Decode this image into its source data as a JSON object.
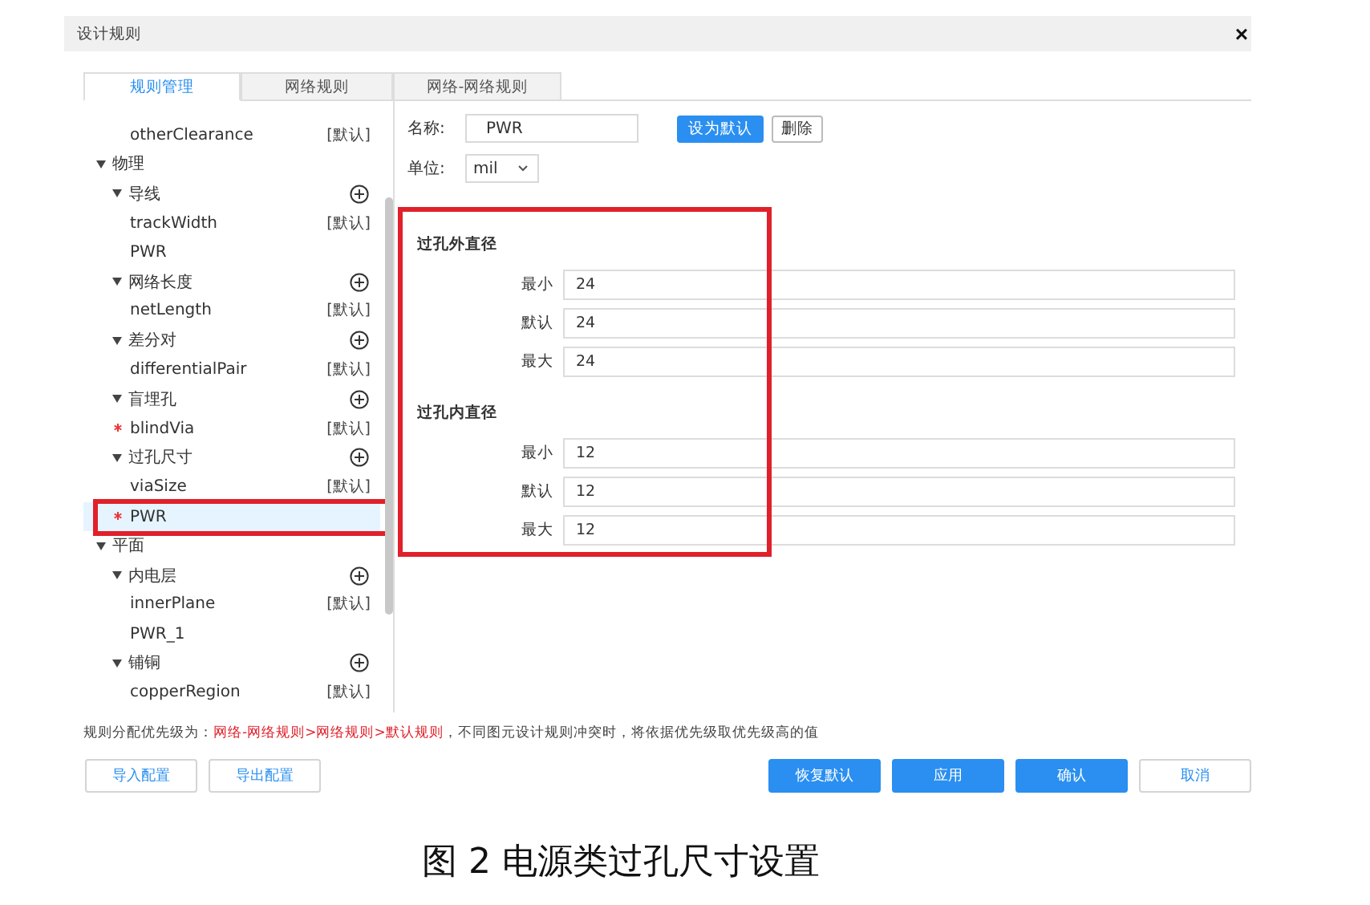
{
  "window": {
    "title": "设计规则",
    "close": "×"
  },
  "tabs": [
    {
      "label": "规则管理",
      "selected": true
    },
    {
      "label": "网络规则",
      "selected": false
    },
    {
      "label": "网络-网络规则",
      "selected": false
    }
  ],
  "tree": [
    {
      "kind": "rule",
      "label": "otherClearance",
      "tag": "[默认]",
      "modified": false,
      "selected": false,
      "highlighted": false
    },
    {
      "kind": "category",
      "label": "物理",
      "expanded": true,
      "children": [
        {
          "kind": "group",
          "label": "导线",
          "expanded": true,
          "children": [
            {
              "kind": "rule",
              "label": "trackWidth",
              "tag": "[默认]",
              "modified": false,
              "selected": false,
              "highlighted": false
            },
            {
              "kind": "rule",
              "label": "PWR",
              "modified": false,
              "selected": false,
              "highlighted": false
            }
          ]
        },
        {
          "kind": "group",
          "label": "网络长度",
          "expanded": true,
          "children": [
            {
              "kind": "rule",
              "label": "netLength",
              "tag": "[默认]",
              "modified": false,
              "selected": false,
              "highlighted": false
            }
          ]
        },
        {
          "kind": "group",
          "label": "差分对",
          "expanded": true,
          "children": [
            {
              "kind": "rule",
              "label": "differentialPair",
              "tag": "[默认]",
              "modified": false,
              "selected": false,
              "highlighted": false
            }
          ]
        },
        {
          "kind": "group",
          "label": "盲埋孔",
          "expanded": true,
          "children": [
            {
              "kind": "rule",
              "label": "blindVia",
              "tag": "[默认]",
              "modified": true,
              "selected": false,
              "highlighted": false
            }
          ]
        },
        {
          "kind": "group",
          "label": "过孔尺寸",
          "expanded": true,
          "children": [
            {
              "kind": "rule",
              "label": "viaSize",
              "tag": "[默认]",
              "modified": false,
              "selected": false,
              "highlighted": false
            },
            {
              "kind": "rule",
              "label": "PWR",
              "modified": true,
              "selected": true,
              "highlighted": true
            }
          ]
        }
      ]
    },
    {
      "kind": "category",
      "label": "平面",
      "expanded": true,
      "children": [
        {
          "kind": "group",
          "label": "内电层",
          "expanded": true,
          "children": [
            {
              "kind": "rule",
              "label": "innerPlane",
              "tag": "[默认]",
              "modified": false,
              "selected": false,
              "highlighted": false
            },
            {
              "kind": "rule",
              "label": "PWR_1",
              "modified": false,
              "selected": false,
              "highlighted": false
            }
          ]
        },
        {
          "kind": "group",
          "label": "铺铜",
          "expanded": true,
          "children": [
            {
              "kind": "rule",
              "label": "copperRegion",
              "tag": "[默认]",
              "modified": false,
              "selected": false,
              "highlighted": false
            }
          ]
        }
      ]
    }
  ],
  "form": {
    "name": {
      "label": "名称:",
      "value": "PWR"
    },
    "name_buttons": [
      {
        "label": "设为默认",
        "kind": "primary"
      },
      {
        "label": "删除",
        "kind": "plain"
      }
    ],
    "unit": {
      "label": "单位:",
      "value": "mil"
    },
    "highlighted": true,
    "sections": [
      {
        "title": "过孔外直径",
        "fields": [
          {
            "label": "最小",
            "value": "24"
          },
          {
            "label": "默认",
            "value": "24"
          },
          {
            "label": "最大",
            "value": "24"
          }
        ]
      },
      {
        "title": "过孔内直径",
        "fields": [
          {
            "label": "最小",
            "value": "12"
          },
          {
            "label": "默认",
            "value": "12"
          },
          {
            "label": "最大",
            "value": "12"
          }
        ]
      }
    ]
  },
  "note": {
    "prefix": "规则分配优先级为：",
    "highlight": "网络-网络规则>网络规则>默认规则",
    "suffix": "，不同图元设计规则冲突时，将依据优先级取优先级高的值"
  },
  "footer_left": [
    {
      "label": "导入配置",
      "kind": "secondary"
    },
    {
      "label": "导出配置",
      "kind": "secondary"
    }
  ],
  "footer_right": [
    {
      "label": "恢复默认",
      "kind": "primary"
    },
    {
      "label": "应用",
      "kind": "primary"
    },
    {
      "label": "确认",
      "kind": "primary"
    },
    {
      "label": "取消",
      "kind": "secondary"
    }
  ],
  "caption": "图 2 电源类过孔尺寸设置"
}
